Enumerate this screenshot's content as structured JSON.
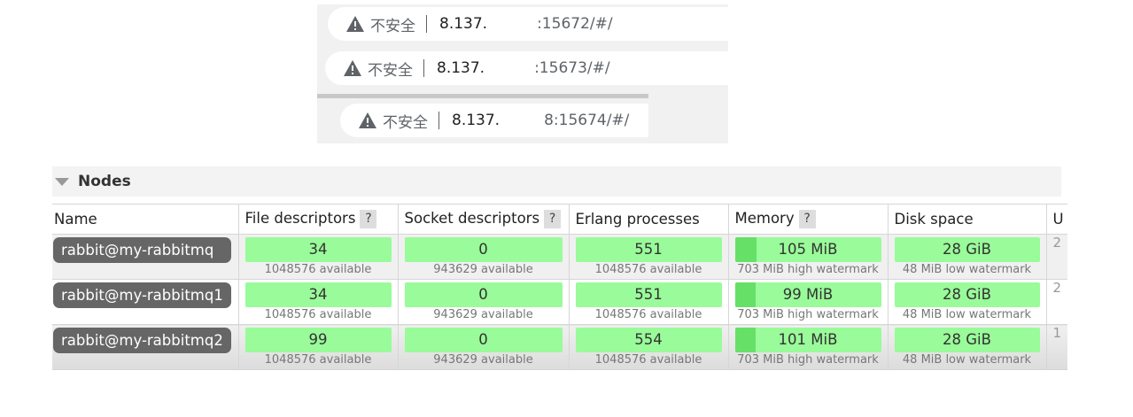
{
  "address_bars": [
    {
      "warning_icon": "warning-triangle-icon",
      "security_label": "不安全",
      "host": "8.137.",
      "port_path": ":15672/#/"
    },
    {
      "warning_icon": "warning-triangle-icon",
      "security_label": "不安全",
      "host": "8.137.",
      "port_path": ":15673/#/"
    },
    {
      "warning_icon": "warning-triangle-icon",
      "security_label": "不安全",
      "host": "8.137.",
      "port_path": "8:15674/#/"
    }
  ],
  "nodes_panel": {
    "title": "Nodes",
    "columns": {
      "name": "Name",
      "file_descriptors": "File descriptors",
      "socket_descriptors": "Socket descriptors",
      "erlang_processes": "Erlang processes",
      "memory": "Memory",
      "disk_space": "Disk space",
      "truncated": "U"
    },
    "help_glyph": "?",
    "rows": [
      {
        "name": "rabbit@my-rabbitmq",
        "fd": "34",
        "fd_avail": "1048576 available",
        "sd": "0",
        "sd_avail": "943629 available",
        "ep": "551",
        "ep_avail": "1048576 available",
        "mem": "105 MiB",
        "mem_wm": "703 MiB high watermark",
        "mem_fraction": 0.149,
        "disk": "28 GiB",
        "disk_wm": "48 MiB low watermark",
        "truncated": "2"
      },
      {
        "name": "rabbit@my-rabbitmq1",
        "fd": "34",
        "fd_avail": "1048576 available",
        "sd": "0",
        "sd_avail": "943629 available",
        "ep": "551",
        "ep_avail": "1048576 available",
        "mem": "99 MiB",
        "mem_wm": "703 MiB high watermark",
        "mem_fraction": 0.141,
        "disk": "28 GiB",
        "disk_wm": "48 MiB low watermark",
        "truncated": "2"
      },
      {
        "name": "rabbit@my-rabbitmq2",
        "fd": "99",
        "fd_avail": "1048576 available",
        "sd": "0",
        "sd_avail": "943629 available",
        "ep": "554",
        "ep_avail": "1048576 available",
        "mem": "101 MiB",
        "mem_wm": "703 MiB high watermark",
        "mem_fraction": 0.144,
        "disk": "28 GiB",
        "disk_wm": "48 MiB low watermark",
        "truncated": "1"
      }
    ],
    "colors": {
      "bar_green": "#99fb99",
      "bar_fill": "#66e066",
      "node_pill": "#666666"
    }
  }
}
